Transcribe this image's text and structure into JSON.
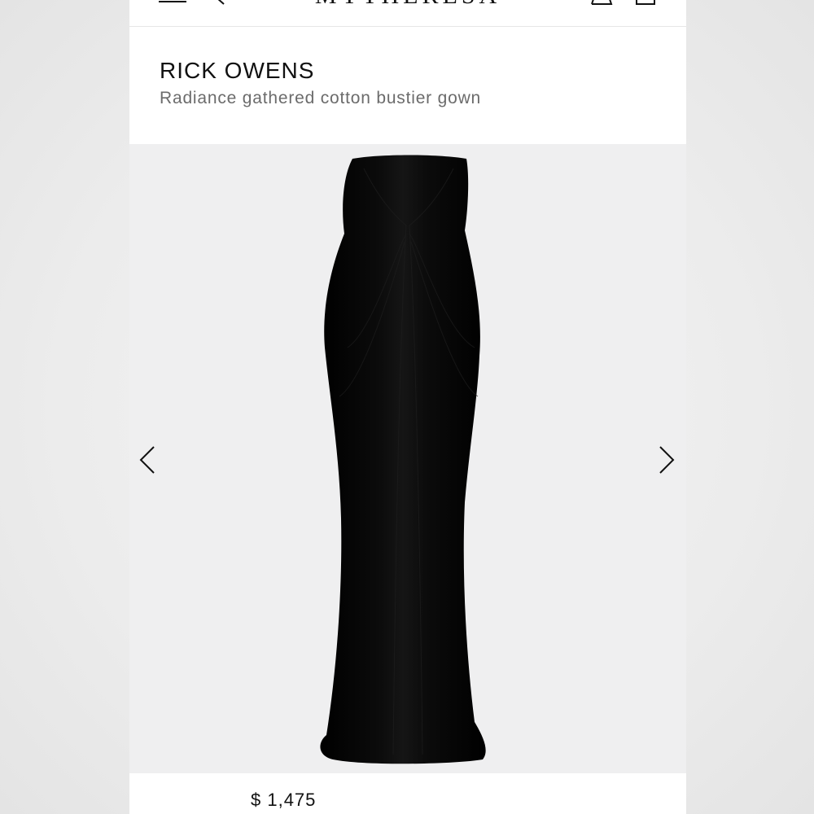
{
  "topbar": {
    "logo": "MYTHERESA",
    "icons": [
      "menu-icon",
      "search-icon",
      "account-icon",
      "bag-icon"
    ]
  },
  "product": {
    "brand": "RICK OWENS",
    "name": "Radiance gathered cotton bustier gown",
    "price": "$ 1,475"
  },
  "gallery": {
    "prev_icon": "chevron-left-icon",
    "next_icon": "chevron-right-icon"
  },
  "colors": {
    "background": "#ececec",
    "card": "#ffffff",
    "gallery_bg": "#efeff0",
    "text": "#111111",
    "muted": "#6b6b6b",
    "dress": "#050505"
  }
}
